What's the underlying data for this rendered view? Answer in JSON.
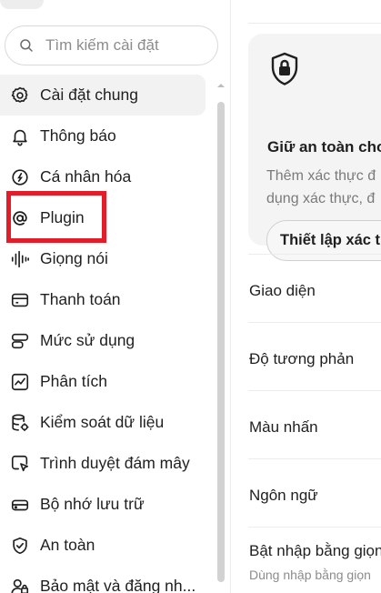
{
  "search": {
    "placeholder": "Tìm kiếm cài đặt"
  },
  "sidebar": {
    "items": [
      {
        "label": "Cài đặt chung",
        "icon": "gear-icon"
      },
      {
        "label": "Thông báo",
        "icon": "bell-icon"
      },
      {
        "label": "Cá nhân hóa",
        "icon": "personalize-icon"
      },
      {
        "label": "Plugin",
        "icon": "plugin-icon"
      },
      {
        "label": "Giọng nói",
        "icon": "voice-waveform-icon"
      },
      {
        "label": "Thanh toán",
        "icon": "credit-card-icon"
      },
      {
        "label": "Mức sử dụng",
        "icon": "usage-icon"
      },
      {
        "label": "Phân tích",
        "icon": "analytics-chart-icon"
      },
      {
        "label": "Kiểm soát dữ liệu",
        "icon": "database-icon"
      },
      {
        "label": "Trình duyệt đám mây",
        "icon": "cloud-browser-icon"
      },
      {
        "label": "Bộ nhớ lưu trữ",
        "icon": "storage-icon"
      },
      {
        "label": "An toàn",
        "icon": "shield-icon"
      },
      {
        "label": "Bảo mật và đăng nh...",
        "icon": "account-security-icon"
      }
    ],
    "highlight_color": "#e11d2a"
  },
  "security_card": {
    "icon": "lock-shield-icon",
    "title": "Giữ an toàn cho",
    "desc_line1": "Thêm xác thực đ",
    "desc_line2": "dụng xác thực, đ",
    "button_label": "Thiết lập xác t"
  },
  "settings": {
    "appearance_label": "Giao diện",
    "contrast_label": "Độ tương phản",
    "accent_label": "Màu nhấn",
    "language_label": "Ngôn ngữ",
    "voice_input_label": "Bật nhập bằng giọn",
    "voice_input_desc": "Dùng nhập bằng giọn"
  }
}
